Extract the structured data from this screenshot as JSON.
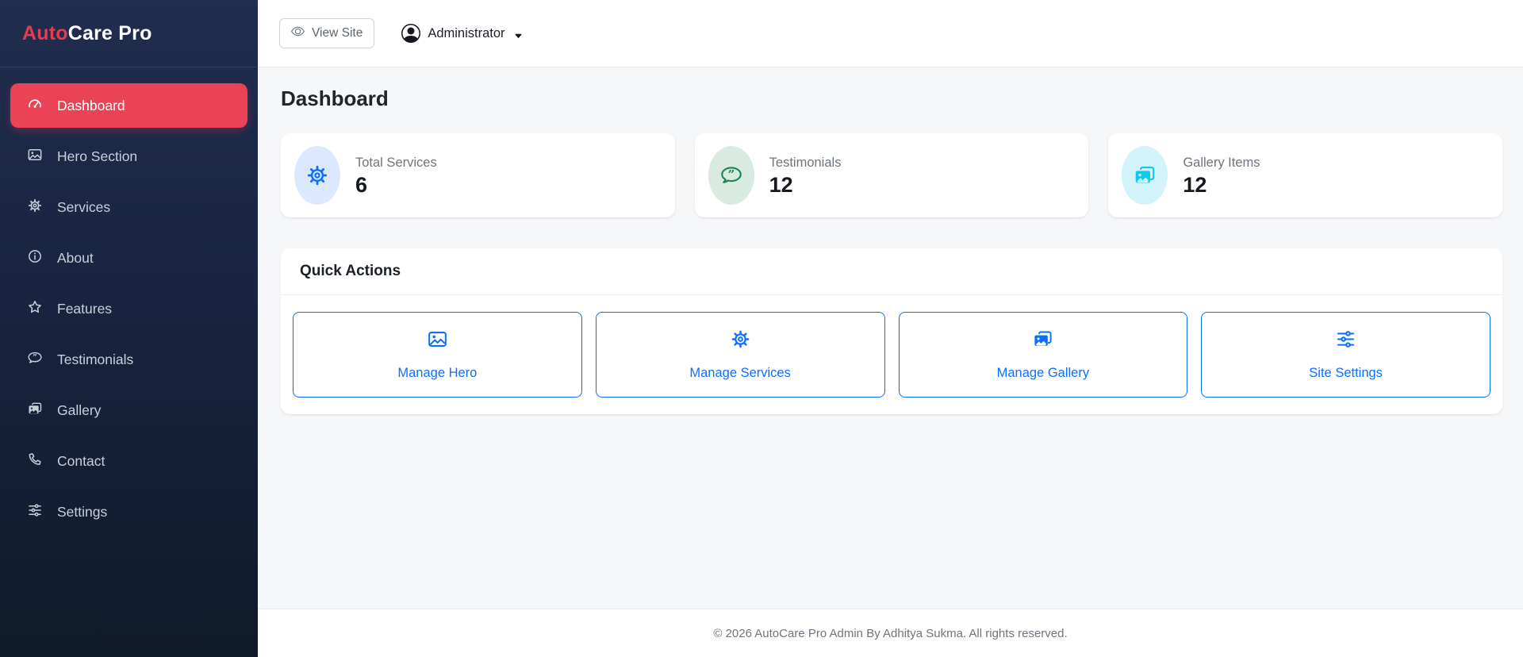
{
  "brand": {
    "name_red": "Auto",
    "name_rest": "Care Pro"
  },
  "sidebar": {
    "items": [
      {
        "label": "Dashboard",
        "icon": "speedometer-icon",
        "active": true
      },
      {
        "label": "Hero Section",
        "icon": "image-icon",
        "active": false
      },
      {
        "label": "Services",
        "icon": "gear-icon",
        "active": false
      },
      {
        "label": "About",
        "icon": "info-circle-icon",
        "active": false
      },
      {
        "label": "Features",
        "icon": "star-icon",
        "active": false
      },
      {
        "label": "Testimonials",
        "icon": "chat-quote-icon",
        "active": false
      },
      {
        "label": "Gallery",
        "icon": "images-icon",
        "active": false
      },
      {
        "label": "Contact",
        "icon": "telephone-icon",
        "active": false
      },
      {
        "label": "Settings",
        "icon": "sliders-icon",
        "active": false
      }
    ]
  },
  "topbar": {
    "view_site_label": "View Site",
    "user_label": "Administrator"
  },
  "page": {
    "title": "Dashboard"
  },
  "stats": [
    {
      "label": "Total Services",
      "value": "6",
      "icon": "gear-icon",
      "icon_color": "#0d6efd",
      "icon_bg": "#dce8fd"
    },
    {
      "label": "Testimonials",
      "value": "12",
      "icon": "chat-quote-icon",
      "icon_color": "#198754",
      "icon_bg": "#d9eae0"
    },
    {
      "label": "Gallery Items",
      "value": "12",
      "icon": "images-icon",
      "icon_color": "#0dcaf0",
      "icon_bg": "#d3f3fb"
    }
  ],
  "quick_actions": {
    "title": "Quick Actions",
    "actions": [
      {
        "label": "Manage Hero",
        "icon": "image-icon"
      },
      {
        "label": "Manage Services",
        "icon": "gear-icon"
      },
      {
        "label": "Manage Gallery",
        "icon": "images-icon"
      },
      {
        "label": "Site Settings",
        "icon": "sliders-icon"
      }
    ]
  },
  "footer": {
    "text": "© 2026 AutoCare Pro Admin By Adhitya Sukma. All rights reserved."
  },
  "colors": {
    "sidebar_top": "#202d4e",
    "sidebar_bottom": "#0f1a2a",
    "active_item_red": "#ea4355",
    "brand_red": "#e63c4f",
    "primary_blue": "#0d6efd",
    "success_green": "#198754",
    "info_cyan": "#0dcaf0",
    "content_bg": "#f6f7f9",
    "muted_text": "#6c757d"
  }
}
